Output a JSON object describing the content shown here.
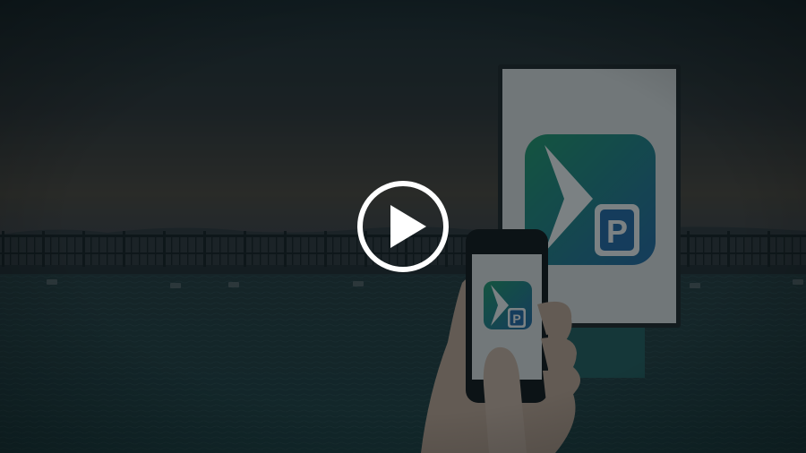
{
  "video": {
    "state": "paused",
    "thumbnail_subject": "phone-casting-to-digital-signage",
    "play_button_icon": "play-icon"
  },
  "app_logo": {
    "icon": "app-logo-icon",
    "badge_letter": "P",
    "gradient_start": "#1b9c6a",
    "gradient_end": "#1e66a8"
  },
  "colors": {
    "sky_top": "#162226",
    "sky_glow": "#4a4036",
    "sea": "#1b3a3d",
    "overlay": "#0e1a1d",
    "play_button": "#ffffff"
  }
}
